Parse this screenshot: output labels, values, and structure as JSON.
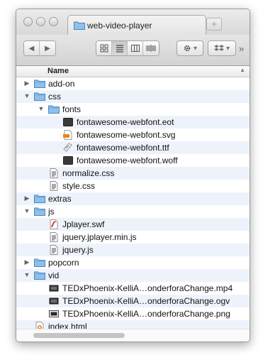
{
  "window": {
    "tab_title": "web-video-player",
    "new_tab": "+"
  },
  "toolbar": {
    "back": "◀",
    "forward": "▶",
    "action_caret": "▾",
    "dropbox_caret": "▾",
    "more": "»"
  },
  "header": {
    "name": "Name",
    "sort": "▲"
  },
  "rows": [
    {
      "label": "add-on",
      "level": 0,
      "kind": "folder",
      "disclosure": "closed"
    },
    {
      "label": "css",
      "level": 0,
      "kind": "folder",
      "disclosure": "open"
    },
    {
      "label": "fonts",
      "level": 1,
      "kind": "folder",
      "disclosure": "open"
    },
    {
      "label": "fontawesome-webfont.eot",
      "level": 2,
      "kind": "black-file"
    },
    {
      "label": "fontawesome-webfont.svg",
      "level": 2,
      "kind": "svg-file"
    },
    {
      "label": "fontawesome-webfont.ttf",
      "level": 2,
      "kind": "ttf-file"
    },
    {
      "label": "fontawesome-webfont.woff",
      "level": 2,
      "kind": "black-file"
    },
    {
      "label": "normalize.css",
      "level": 1,
      "kind": "text-file"
    },
    {
      "label": "style.css",
      "level": 1,
      "kind": "text-file"
    },
    {
      "label": "extras",
      "level": 0,
      "kind": "folder",
      "disclosure": "closed"
    },
    {
      "label": "js",
      "level": 0,
      "kind": "folder",
      "disclosure": "open"
    },
    {
      "label": "Jplayer.swf",
      "level": 1,
      "kind": "swf-file"
    },
    {
      "label": "jquery.jplayer.min.js",
      "level": 1,
      "kind": "text-file"
    },
    {
      "label": "jquery.js",
      "level": 1,
      "kind": "text-file"
    },
    {
      "label": "popcorn",
      "level": 0,
      "kind": "folder",
      "disclosure": "closed"
    },
    {
      "label": "vid",
      "level": 0,
      "kind": "folder",
      "disclosure": "open"
    },
    {
      "label": "TEDxPhoenix-KelliA…onderforaChange.mp4",
      "level": 1,
      "kind": "video-file"
    },
    {
      "label": "TEDxPhoenix-KelliA…onderforaChange.ogv",
      "level": 1,
      "kind": "video-file"
    },
    {
      "label": "TEDxPhoenix-KelliA…onderforaChange.png",
      "level": 1,
      "kind": "image-file"
    },
    {
      "label": "index.html",
      "level": 0,
      "kind": "html-file"
    }
  ]
}
